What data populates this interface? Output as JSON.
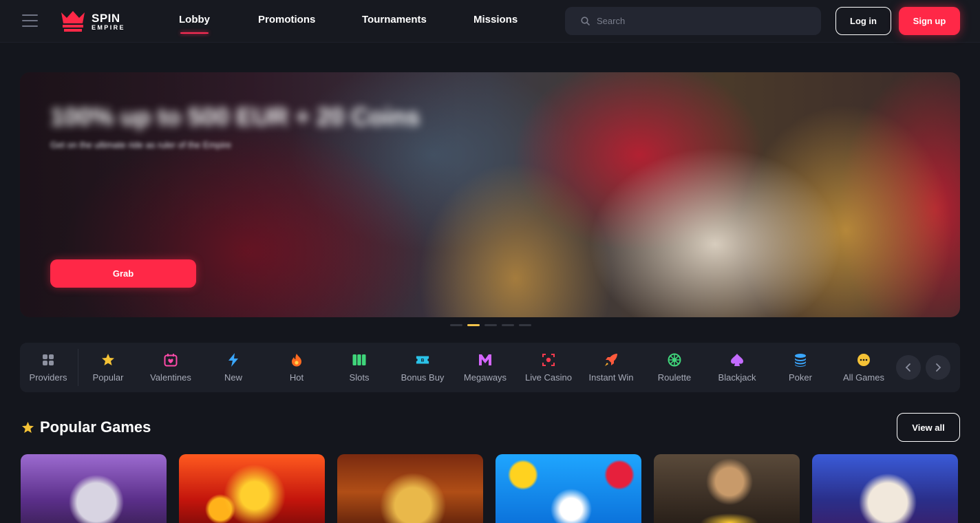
{
  "header": {
    "logo_line1": "SPIN",
    "logo_line2": "EMPIRE",
    "nav": [
      {
        "label": "Lobby",
        "active": true
      },
      {
        "label": "Promotions",
        "active": false
      },
      {
        "label": "Tournaments",
        "active": false
      },
      {
        "label": "Missions",
        "active": false
      }
    ],
    "search_placeholder": "Search",
    "login_label": "Log in",
    "signup_label": "Sign up"
  },
  "hero": {
    "title": "100% up to 500 EUR + 20 Coins",
    "subtitle": "Get on the ultimate ride as ruler of the Empire",
    "cta_label": "Grab",
    "slides_total": 5,
    "active_slide": 2
  },
  "categories": [
    {
      "label": "Providers",
      "icon": "grid-icon"
    },
    {
      "label": "Popular",
      "icon": "star-icon"
    },
    {
      "label": "Valentines",
      "icon": "calendar-heart-icon"
    },
    {
      "label": "New",
      "icon": "lightning-icon"
    },
    {
      "label": "Hot",
      "icon": "flame-icon"
    },
    {
      "label": "Slots",
      "icon": "slots-icon"
    },
    {
      "label": "Bonus Buy",
      "icon": "ticket-icon"
    },
    {
      "label": "Megaways",
      "icon": "megaways-icon"
    },
    {
      "label": "Live Casino",
      "icon": "live-icon"
    },
    {
      "label": "Instant Win",
      "icon": "rocket-icon"
    },
    {
      "label": "Roulette",
      "icon": "roulette-icon"
    },
    {
      "label": "Blackjack",
      "icon": "spade-icon"
    },
    {
      "label": "Poker",
      "icon": "chips-icon"
    },
    {
      "label": "All Games",
      "icon": "dots-icon"
    }
  ],
  "popular": {
    "title": "Popular Games",
    "view_all_label": "View all"
  },
  "colors": {
    "accent": "#ff2847",
    "active_dot": "#f3c44c",
    "background": "#14161d"
  }
}
